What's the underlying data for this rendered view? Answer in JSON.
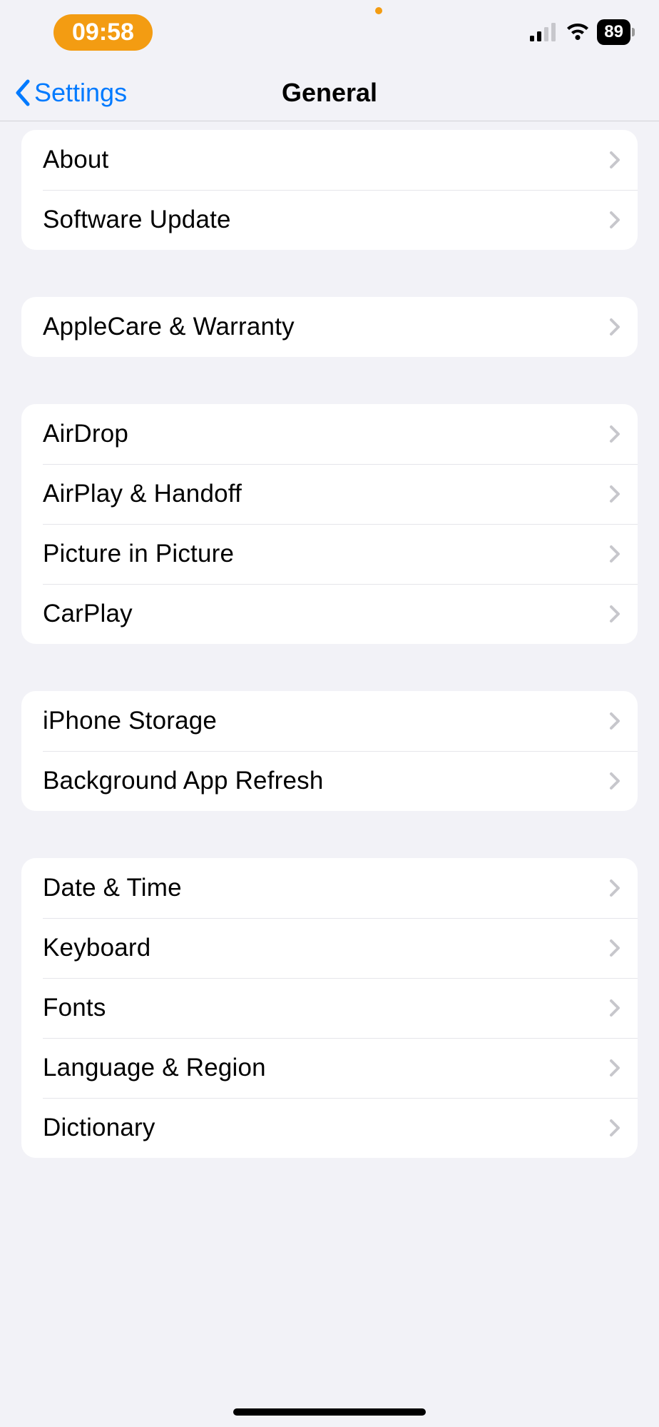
{
  "status": {
    "time": "09:58",
    "battery": "89"
  },
  "nav": {
    "back": "Settings",
    "title": "General"
  },
  "sections": [
    {
      "items": [
        "About",
        "Software Update"
      ]
    },
    {
      "items": [
        "AppleCare & Warranty"
      ]
    },
    {
      "items": [
        "AirDrop",
        "AirPlay & Handoff",
        "Picture in Picture",
        "CarPlay"
      ]
    },
    {
      "items": [
        "iPhone Storage",
        "Background App Refresh"
      ]
    },
    {
      "items": [
        "Date & Time",
        "Keyboard",
        "Fonts",
        "Language & Region",
        "Dictionary"
      ]
    }
  ]
}
